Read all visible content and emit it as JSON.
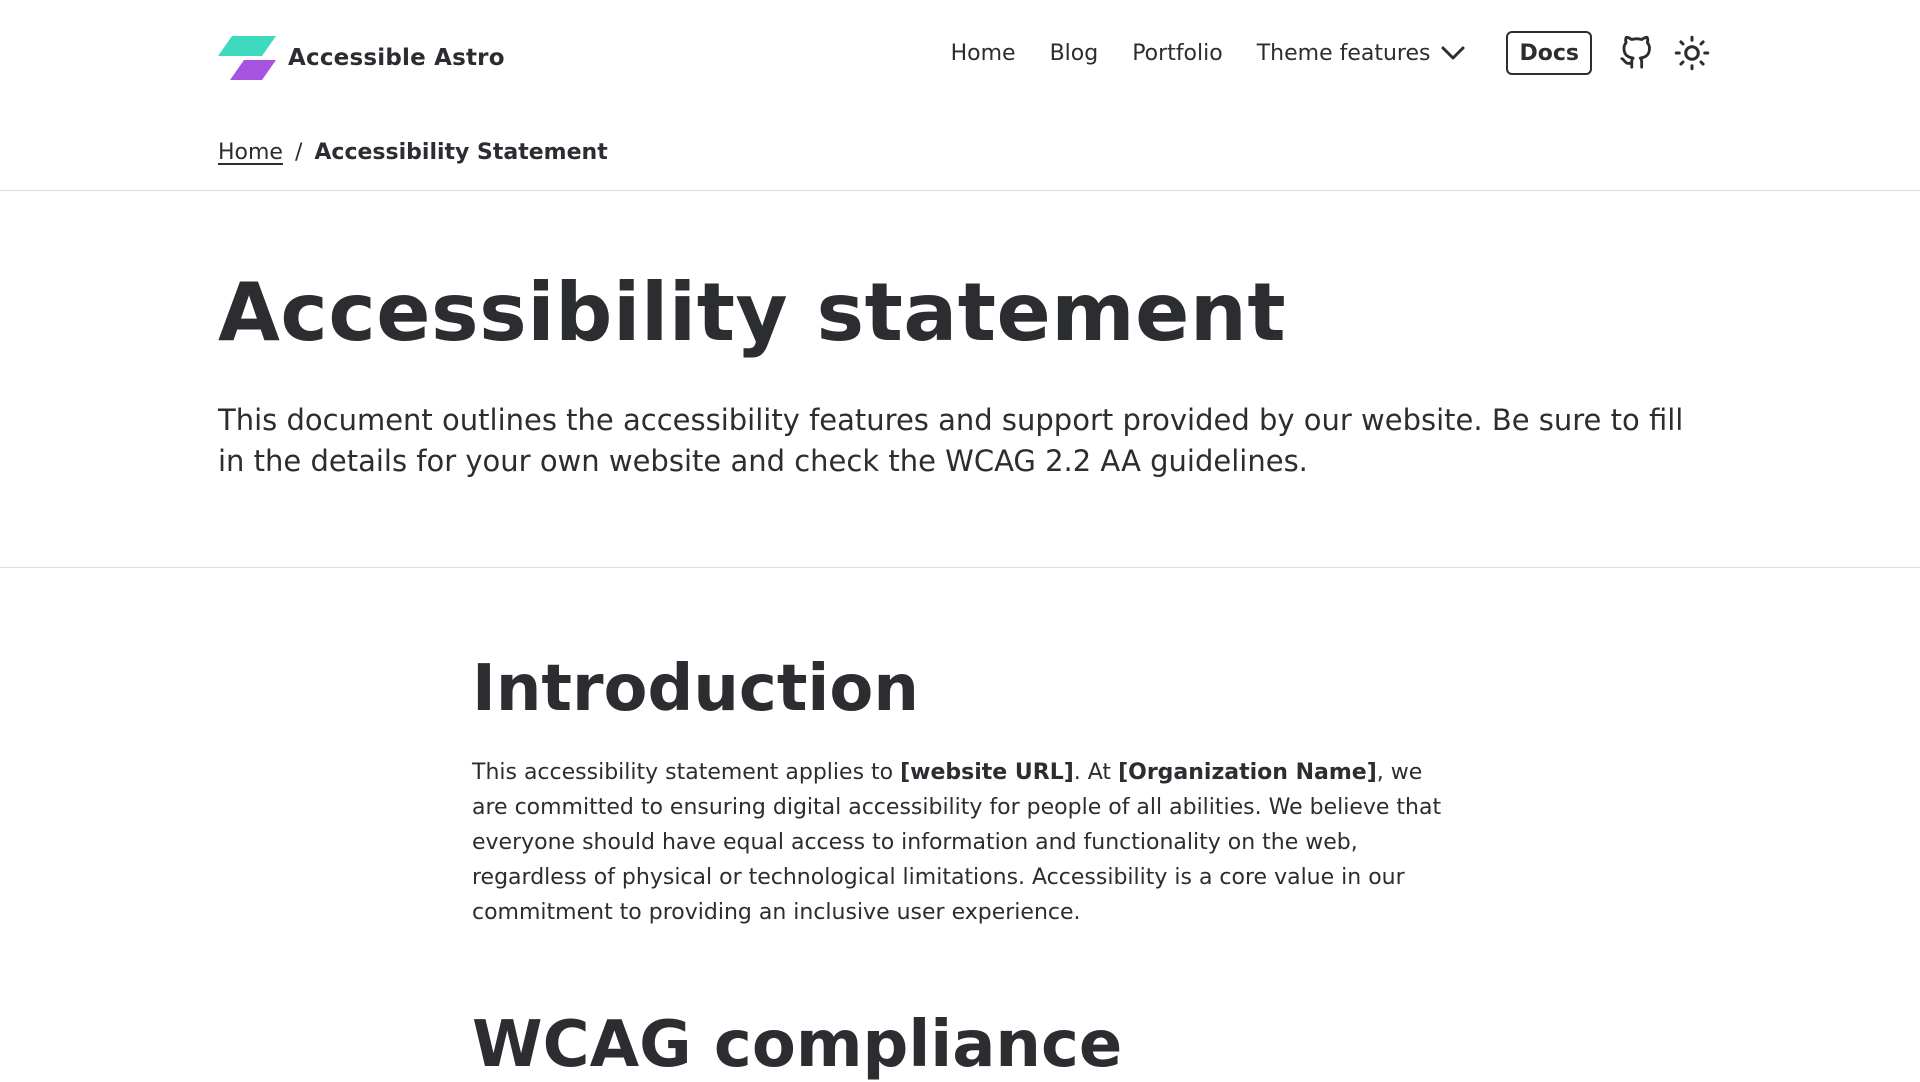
{
  "header": {
    "brand_name": "Accessible Astro",
    "brand_colors": {
      "top": "#3fd9c0",
      "bottom": "#a653e0"
    },
    "nav": {
      "home": "Home",
      "blog": "Blog",
      "portfolio": "Portfolio",
      "theme_features": "Theme features",
      "docs": "Docs"
    },
    "icons": {
      "logo": "logo-mark",
      "dropdown": "chevron-down-icon",
      "github": "github-icon",
      "theme_toggle": "sun-icon"
    }
  },
  "breadcrumb": {
    "home": "Home",
    "separator": "/",
    "current": "Accessibility Statement"
  },
  "hero": {
    "title": "Accessibility statement",
    "lede": "This document outlines the accessibility features and support provided by our website. Be sure to fill in the details for your own website and check the WCAG 2.2 AA guidelines."
  },
  "content": {
    "intro_title": "Introduction",
    "intro": {
      "p1": "This accessibility statement applies to ",
      "website_url": "[website URL]",
      "p2": ". At ",
      "org_name": "[Organization Name]",
      "p3": ", we are committed to ensuring digital accessibility for people of all abilities. We believe that everyone should have equal access to information and functionality on the web, regardless of physical or technological limitations. Accessibility is a core value in our commitment to providing an inclusive user experience."
    },
    "wcag_title": "WCAG compliance"
  }
}
